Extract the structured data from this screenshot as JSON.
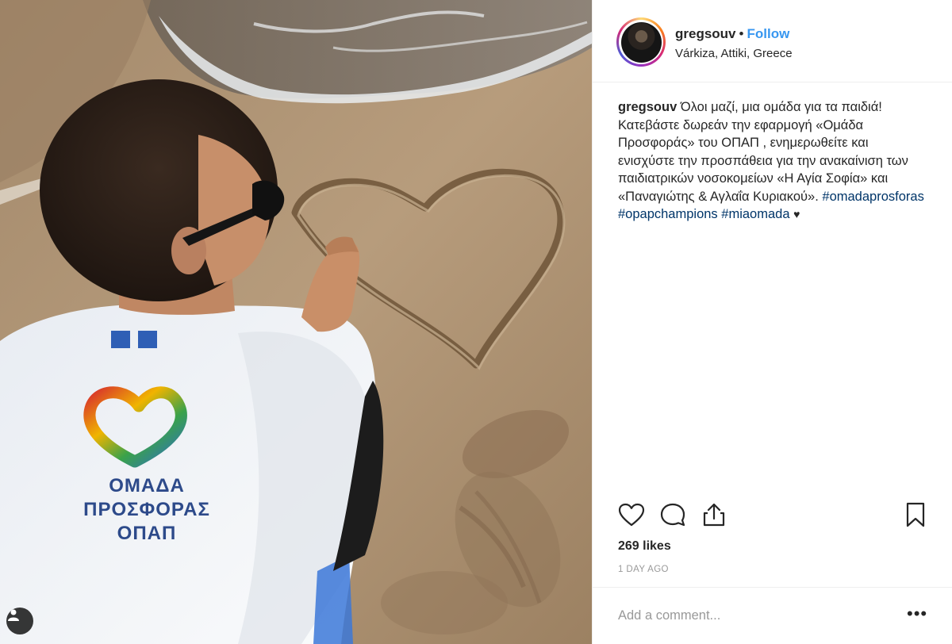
{
  "post": {
    "username": "gregsouv",
    "separator": "•",
    "follow_label": "Follow",
    "location": "Várkiza, Attiki, Greece",
    "caption": {
      "username": "gregsouv",
      "line1": "Όλοι μαζί, μια ομάδα για τα παιδιά!",
      "line2": "Κατεβάστε δωρεάν την εφαρμογή «Ομάδα Προσφοράς» του ΟΠΑΠ , ενημερωθείτε και ενισχύστε την προσπάθεια για την ανακαίνιση των παιδιατρικών νοσοκομείων «Η Αγία Σοφία» και «Παναγιώτης & Αγλαΐα Κυριακού».",
      "hashtags": [
        "#omadaprosforas",
        "#opapchampions",
        "#miaomada"
      ],
      "heart": "♥"
    },
    "likes": "269 likes",
    "timestamp": "1 DAY AGO",
    "comment_placeholder": "Add a comment...",
    "more_label": "•••"
  },
  "photo": {
    "shirt_lines": [
      "ΟΜΑΔΑ",
      "ΠΡΟΣΦΟΡΑΣ",
      "ΟΠΑΠ"
    ]
  },
  "icons": {
    "like": "heart-outline-icon",
    "comment": "speech-bubble-icon",
    "share": "share-icon",
    "save": "bookmark-icon",
    "tagged": "person-tag-icon"
  },
  "colors": {
    "link": "#3897f0",
    "hashtag": "#003569",
    "muted": "#999999",
    "shirt_text": "#2d4a8a"
  }
}
